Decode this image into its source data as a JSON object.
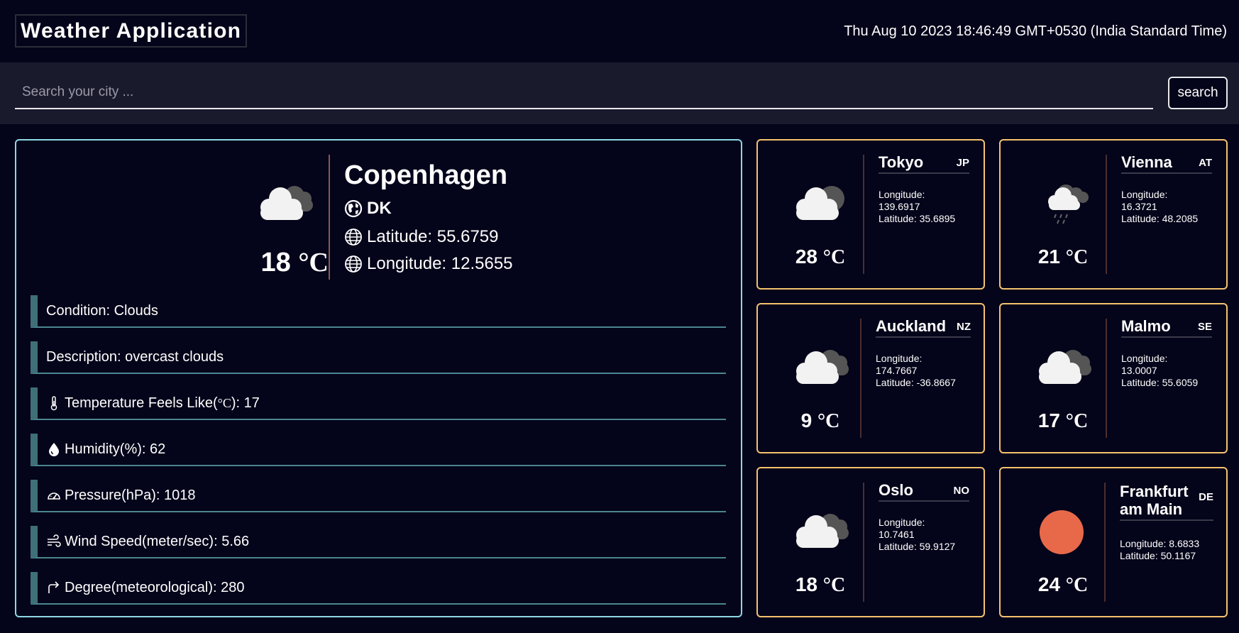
{
  "header": {
    "title": "Weather Application",
    "datetime": "Thu Aug 10 2023 18:46:49 GMT+0530 (India Standard Time)"
  },
  "search": {
    "placeholder": "Search your city ...",
    "value": "",
    "button_label": "search"
  },
  "main": {
    "icon": "overcast-clouds-icon",
    "temp": "18",
    "unit": "°C",
    "city": "Copenhagen",
    "country": "DK",
    "latitude": "Latitude: 55.6759",
    "longitude": "Longitude: 12.5655",
    "details": {
      "condition": "Condition: Clouds",
      "description": "Description: overcast clouds",
      "feels_like_prefix": "Temperature Feels Like(",
      "feels_like_unit": "°C",
      "feels_like_suffix": "): 17",
      "humidity": "Humidity(%): 62",
      "pressure": "Pressure(hPa): 1018",
      "wind": "Wind Speed(meter/sec): 5.66",
      "degree": "Degree(meteorological): 280"
    }
  },
  "cities": [
    {
      "name": "Tokyo",
      "code": "JP",
      "temp": "28",
      "unit": "°C",
      "icon": "broken-clouds-icon",
      "lon_label": "Longitude:",
      "lon": "139.6917",
      "lat": "Latitude: 35.6895"
    },
    {
      "name": "Vienna",
      "code": "AT",
      "temp": "21",
      "unit": "°C",
      "icon": "rain-cloud-icon",
      "lon_label": "Longitude:",
      "lon": "16.3721",
      "lat": "Latitude: 48.2085"
    },
    {
      "name": "Auckland",
      "code": "NZ",
      "temp": "9",
      "unit": "°C",
      "icon": "overcast-clouds-icon",
      "lon_label": "Longitude:",
      "lon": "174.7667",
      "lat": "Latitude: -36.8667"
    },
    {
      "name": "Malmo",
      "code": "SE",
      "temp": "17",
      "unit": "°C",
      "icon": "overcast-clouds-icon",
      "lon_label": "Longitude:",
      "lon": "13.0007",
      "lat": "Latitude: 55.6059"
    },
    {
      "name": "Oslo",
      "code": "NO",
      "temp": "18",
      "unit": "°C",
      "icon": "overcast-clouds-icon",
      "lon_label": "Longitude:",
      "lon": "10.7461",
      "lat": "Latitude: 59.9127"
    },
    {
      "name": "Frankfurt am Main",
      "code": "DE",
      "temp": "24",
      "unit": "°C",
      "icon": "clear-sun-icon",
      "lon_label": "Longitude: 8.6833",
      "lon": "",
      "lat": "Latitude: 50.1167"
    }
  ],
  "colors": {
    "background": "#04041a",
    "search_bar": "#1a1a2d",
    "main_card_border": "#8ed7e4",
    "city_card_border": "#f5c26e",
    "sun": "#e8694a",
    "detail_accent": "#3f6f78"
  }
}
